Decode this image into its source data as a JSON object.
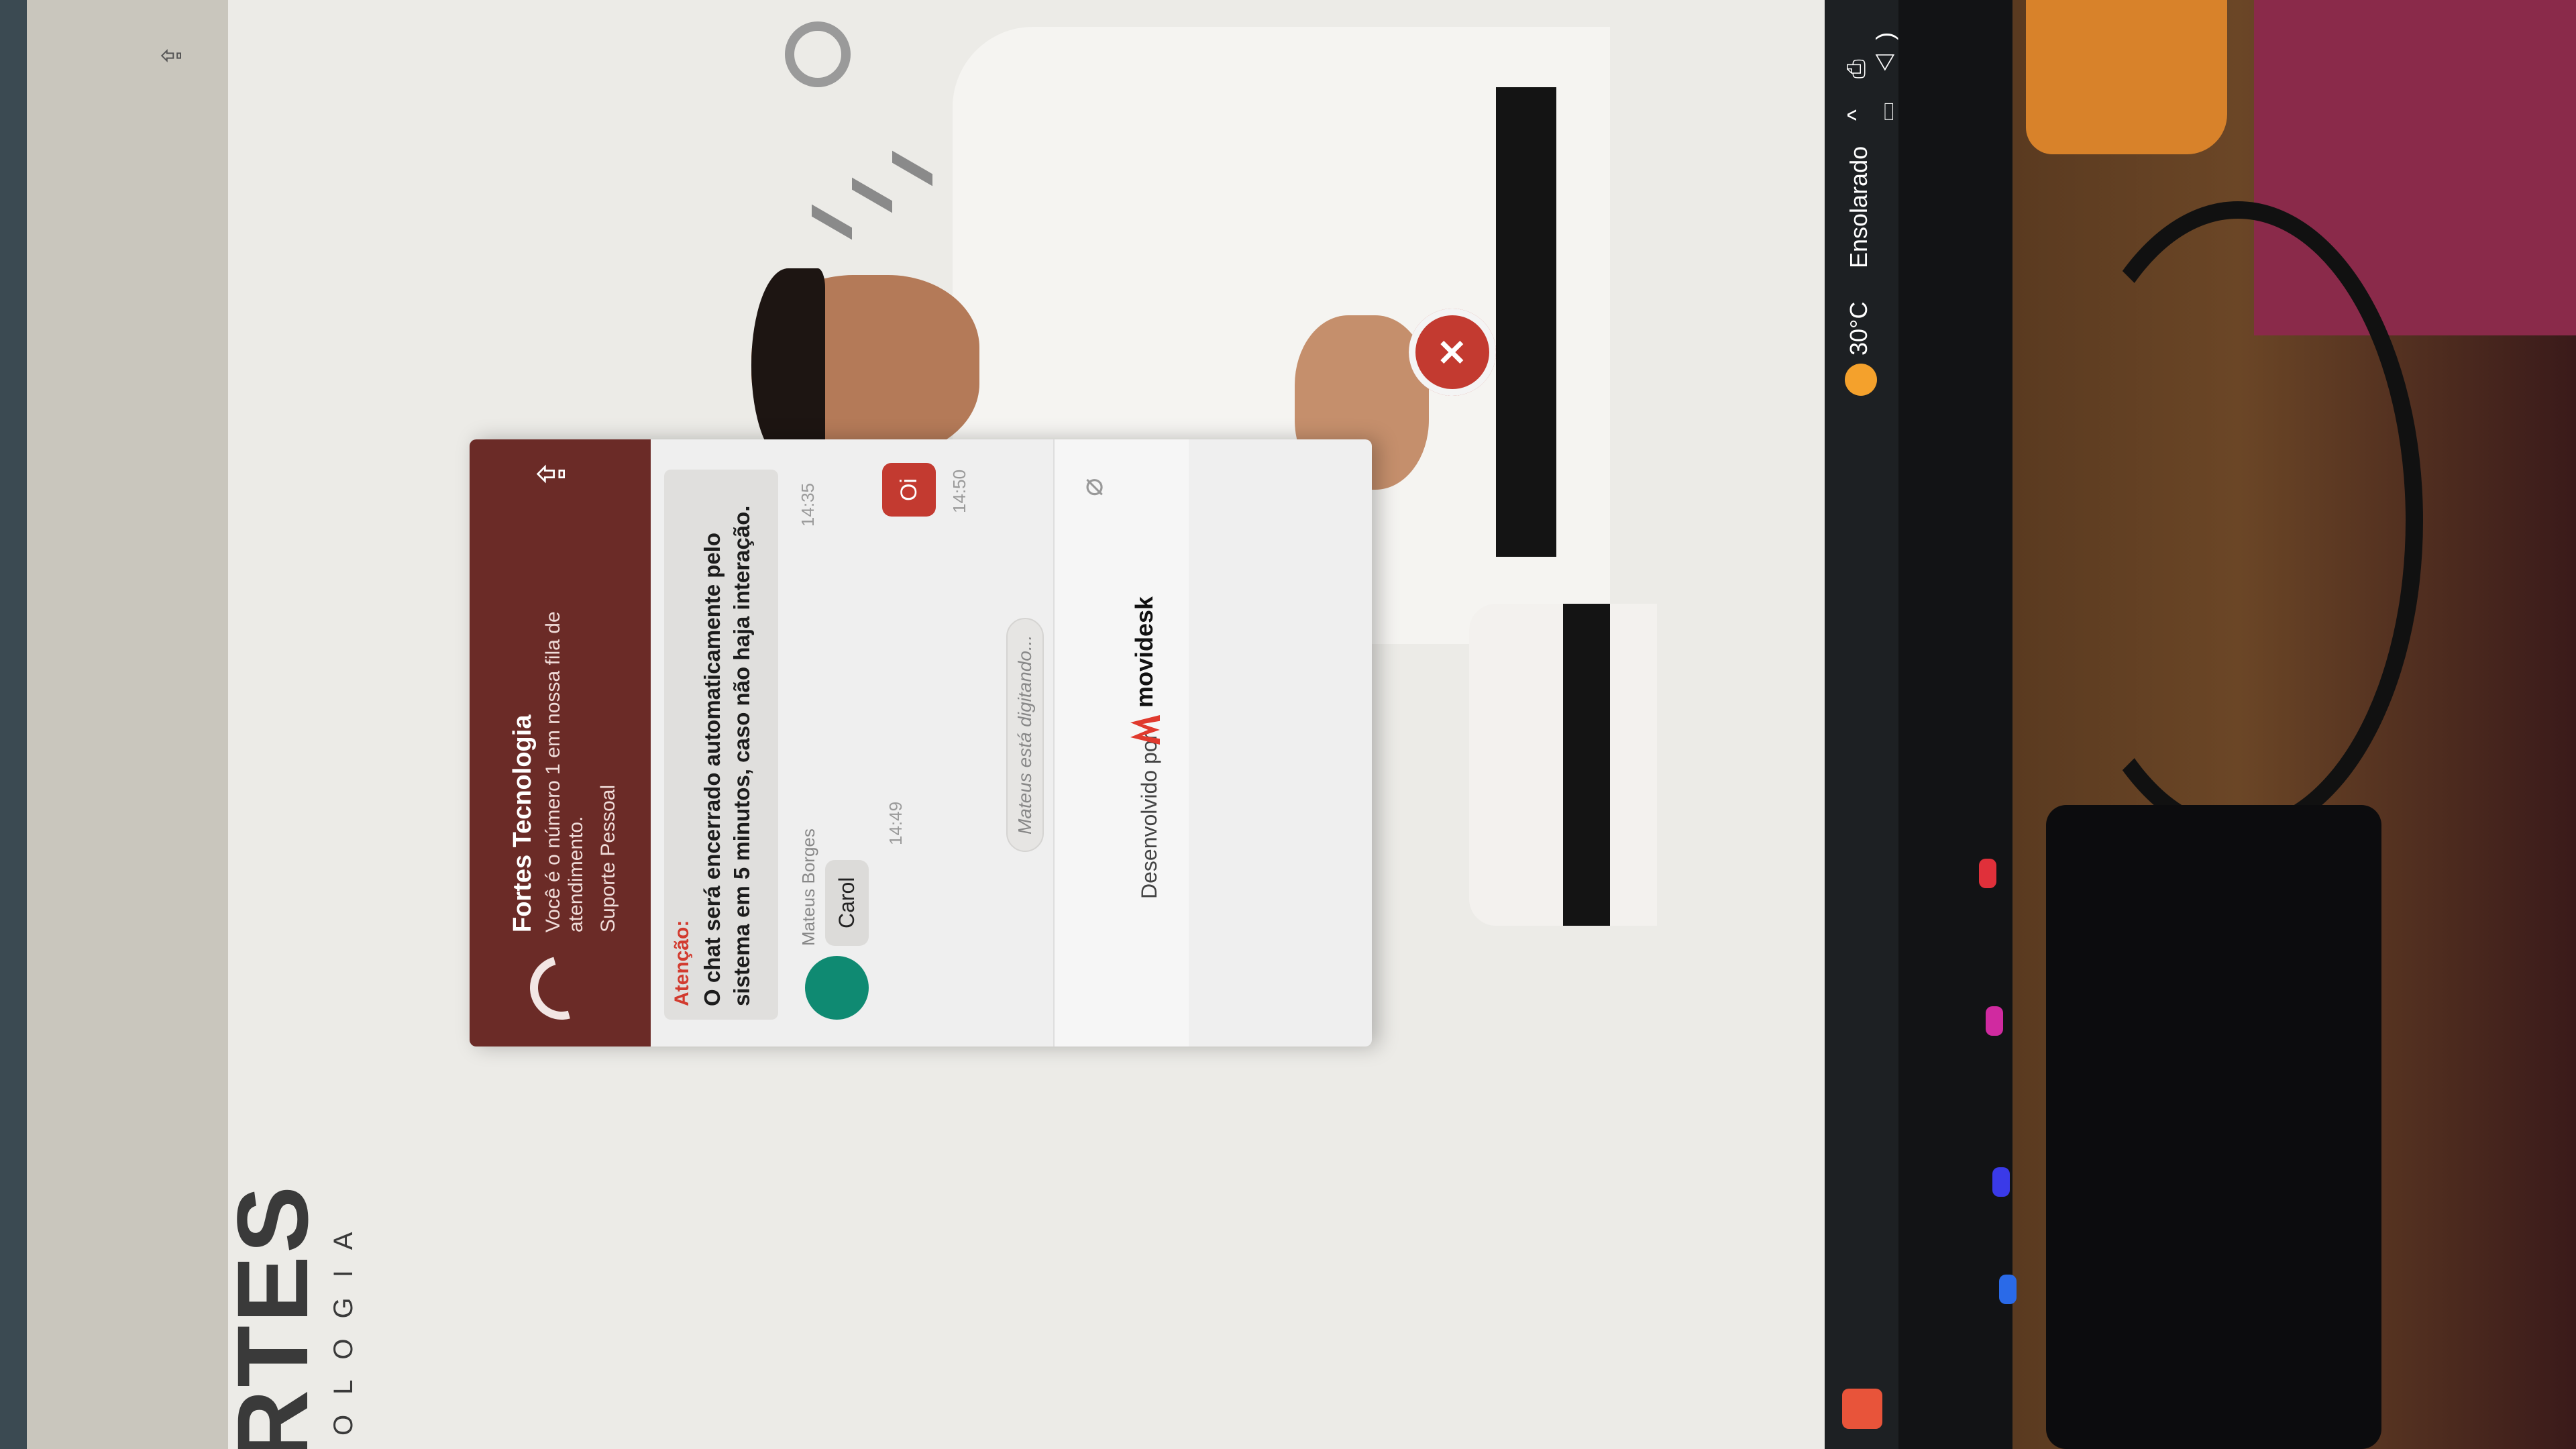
{
  "page": {
    "logo_text": "RTES",
    "logo_sub": "OLOGIA"
  },
  "chat": {
    "title": "Fortes Tecnologia",
    "queue_text": "Você é o número 1 em nossa fila de atendimento.",
    "department": "Suporte Pessoal",
    "notice_label": "Atenção:",
    "notice_text": "O chat será encerrado automaticamente pelo sistema em 5 minutos, caso não haja interação.",
    "notice_time": "14:35",
    "agent_name": "Mateus Borges",
    "agent_message": "Carol",
    "agent_message_time": "14:49",
    "user_message": "Oi",
    "user_message_time": "14:50",
    "typing_indicator": "Mateus está digitando...",
    "powered_by": "Desenvolvido por",
    "brand": "movidesk",
    "icons": {
      "export": "export-icon",
      "attach": "paperclip-icon",
      "close": "close-chat-icon"
    },
    "colors": {
      "header": "#6b2b27",
      "accent": "#c33a30",
      "agent_avatar": "#0f8a72"
    }
  },
  "taskbar": {
    "temperature": "30°C",
    "condition": "Ensolarado"
  }
}
